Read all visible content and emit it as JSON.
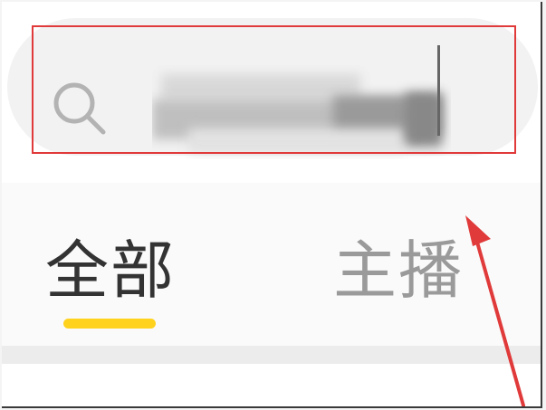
{
  "search": {
    "value": "",
    "icon": "search-icon"
  },
  "tabs": [
    {
      "label": "全部",
      "active": true
    },
    {
      "label": "主播",
      "active": false
    }
  ],
  "colors": {
    "active_tab_text": "#333333",
    "inactive_tab_text": "#9a9a9a",
    "tab_indicator": "#ffd21e",
    "annotation": "#e03a3a"
  },
  "annotation": {
    "highlight": "search-box",
    "arrow_target": "search-box"
  }
}
